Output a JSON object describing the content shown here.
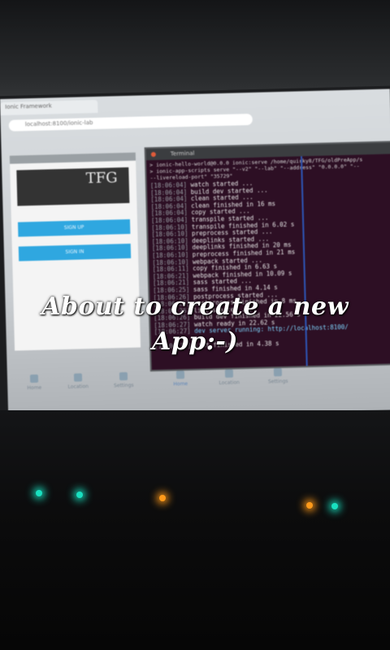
{
  "caption": {
    "line1": "About to create a new",
    "line2": "App:-)"
  },
  "browser": {
    "tab_label": "Ionic Framework",
    "address": "localhost:8100/ionic-lab"
  },
  "phone_app": {
    "logo_text": "TFG",
    "signup_label": "SIGN UP",
    "signin_label": "SIGN IN",
    "tabs": [
      "Home",
      "Location",
      "Settings"
    ]
  },
  "terminal": {
    "title": "Terminal",
    "header": "> ionic-hello-world@0.0.0 ionic:serve /home/quirky8/TFG/oldPreApp/s\n> ionic-app-scripts serve \"--v2\" \"--lab\" \"--address\" \"0.0.0.0\" \"--\n--livereload-port\" \"35729\"",
    "log": [
      {
        "ts": "[18:06:04]",
        "msg": "watch started ..."
      },
      {
        "ts": "[18:06:04]",
        "msg": "build dev started ..."
      },
      {
        "ts": "[18:06:04]",
        "msg": "clean started ..."
      },
      {
        "ts": "[18:06:04]",
        "msg": "clean finished in 16 ms"
      },
      {
        "ts": "[18:06:04]",
        "msg": "copy started ..."
      },
      {
        "ts": "[18:06:04]",
        "msg": "transpile started ..."
      },
      {
        "ts": "[18:06:10]",
        "msg": "transpile finished in 6.02 s"
      },
      {
        "ts": "[18:06:10]",
        "msg": "preprocess started ..."
      },
      {
        "ts": "[18:06:10]",
        "msg": "deeplinks started ..."
      },
      {
        "ts": "[18:06:10]",
        "msg": "deeplinks finished in 20 ms"
      },
      {
        "ts": "[18:06:10]",
        "msg": "preprocess finished in 21 ms"
      },
      {
        "ts": "[18:06:10]",
        "msg": "webpack started ..."
      },
      {
        "ts": "[18:06:11]",
        "msg": "copy finished in 6.63 s"
      },
      {
        "ts": "[18:06:21]",
        "msg": "webpack finished in 10.09 s"
      },
      {
        "ts": "[18:06:21]",
        "msg": "sass started ..."
      },
      {
        "ts": "[18:06:25]",
        "msg": "sass finished in 4.14 s"
      },
      {
        "ts": "[18:06:26]",
        "msg": "postprocess started ..."
      },
      {
        "ts": "[18:06:26]",
        "msg": "postprocess finished in 8 ms"
      },
      {
        "ts": "[18:06:26]",
        "msg": "lint started ..."
      },
      {
        "ts": "[18:06:26]",
        "msg": "build dev finished in 22.56 s"
      },
      {
        "ts": "[18:06:27]",
        "msg": "watch ready in 22.62 s"
      },
      {
        "ts": "[18:06:27]",
        "msg": "dev server running: http://localhost:8100/"
      },
      {
        "ts": "",
        "msg": ""
      },
      {
        "ts": "[18:06:31]",
        "msg": "lint finished in 4.38 s"
      }
    ]
  },
  "lower_tabs": [
    "Home",
    "Location",
    "Settings"
  ],
  "leds": [
    {
      "color": "#19e0c0"
    },
    {
      "color": "#19e0c0"
    },
    {
      "color": "#ff9a1a"
    },
    {
      "color": "#ff9a1a"
    },
    {
      "color": "#19e0c0"
    }
  ]
}
